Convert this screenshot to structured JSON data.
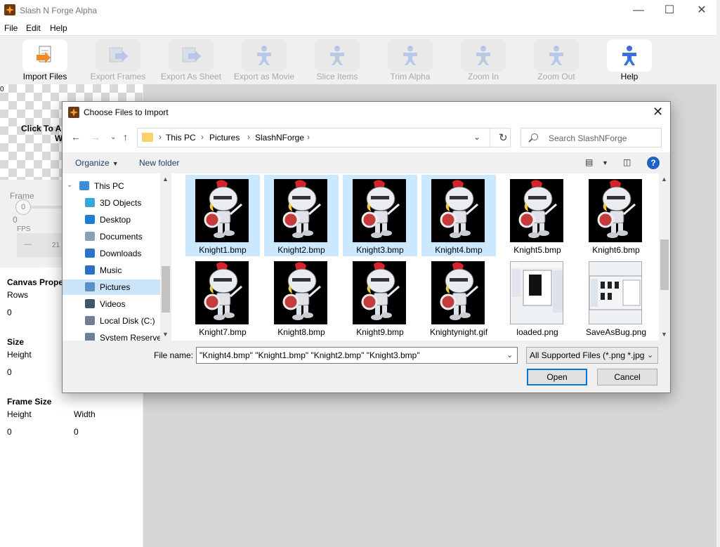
{
  "app": {
    "title": "Slash N Forge Alpha",
    "menu": [
      "File",
      "Edit",
      "Help"
    ],
    "toolbar": [
      {
        "label": "Import Files",
        "enabled": true
      },
      {
        "label": "Export Frames",
        "enabled": false
      },
      {
        "label": "Export As Sheet",
        "enabled": false
      },
      {
        "label": "Export as Movie",
        "enabled": false
      },
      {
        "label": "Slice Items",
        "enabled": false
      },
      {
        "label": "Trim Alpha",
        "enabled": false
      },
      {
        "label": "Zoom In",
        "enabled": false
      },
      {
        "label": "Zoom Out",
        "enabled": false
      },
      {
        "label": "Help",
        "enabled": true
      }
    ],
    "left_panel": {
      "corner_value": "0",
      "canvas_hint_line1": "Click To Ac",
      "canvas_hint_line2": "W",
      "frame_label": "Frame",
      "frame_value": "0",
      "frame_zero": "0",
      "fps_label": "FPS",
      "fps_minus": "—",
      "fps_value": "21",
      "canvas_properties_title": "Canvas Proper",
      "rows_label": "Rows",
      "rows_value": "0",
      "size_title": "Size",
      "size_height_label": "Height",
      "size_height_value": "0",
      "frame_size_title": "Frame Size",
      "fs_height_label": "Height",
      "fs_width_label": "Width",
      "fs_height_value": "0",
      "fs_width_value": "0"
    }
  },
  "dialog": {
    "title": "Choose Files to Import",
    "close": "✕",
    "breadcrumb": [
      "This PC",
      "Pictures",
      "SlashNForge"
    ],
    "search_placeholder": "Search SlashNForge",
    "organize_label": "Organize",
    "new_folder_label": "New folder",
    "help_label": "?",
    "nav_items": [
      {
        "label": "This PC",
        "icon": "pc-icon",
        "color": "#3b8ed8"
      },
      {
        "label": "3D Objects",
        "icon": "cube-icon",
        "color": "#35a7d9"
      },
      {
        "label": "Desktop",
        "icon": "desktop-icon",
        "color": "#1e7fd0"
      },
      {
        "label": "Documents",
        "icon": "documents-icon",
        "color": "#8aa0b4"
      },
      {
        "label": "Downloads",
        "icon": "download-icon",
        "color": "#2a74c9"
      },
      {
        "label": "Music",
        "icon": "music-icon",
        "color": "#2c6fc4"
      },
      {
        "label": "Pictures",
        "icon": "pictures-icon",
        "color": "#5b8fc7"
      },
      {
        "label": "Videos",
        "icon": "videos-icon",
        "color": "#44546a"
      },
      {
        "label": "Local Disk (C:)",
        "icon": "disk-icon",
        "color": "#6f7f91"
      },
      {
        "label": "System Reserved",
        "icon": "disk-icon",
        "color": "#6f7f91"
      }
    ],
    "selected_nav": "Pictures",
    "files": [
      {
        "name": "Knight1.bmp",
        "selected": true,
        "kind": "knight"
      },
      {
        "name": "Knight2.bmp",
        "selected": true,
        "kind": "knight"
      },
      {
        "name": "Knight3.bmp",
        "selected": true,
        "kind": "knight"
      },
      {
        "name": "Knight4.bmp",
        "selected": true,
        "kind": "knight"
      },
      {
        "name": "Knight5.bmp",
        "selected": false,
        "kind": "knight"
      },
      {
        "name": "Knight6.bmp",
        "selected": false,
        "kind": "knight"
      },
      {
        "name": "Knight7.bmp",
        "selected": false,
        "kind": "knight"
      },
      {
        "name": "Knight8.bmp",
        "selected": false,
        "kind": "knight"
      },
      {
        "name": "Knight9.bmp",
        "selected": false,
        "kind": "knight"
      },
      {
        "name": "Knightynight.gif",
        "selected": false,
        "kind": "knight"
      },
      {
        "name": "loaded.png",
        "selected": false,
        "kind": "screenshot"
      },
      {
        "name": "SaveAsBug.png",
        "selected": false,
        "kind": "screenshot"
      }
    ],
    "file_name_label": "File name:",
    "file_name_value": "\"Knight4.bmp\" \"Knight1.bmp\" \"Knight2.bmp\" \"Knight3.bmp\"",
    "file_type_value": "All Supported Files (*.png *.jpg",
    "open_label": "Open",
    "cancel_label": "Cancel"
  }
}
